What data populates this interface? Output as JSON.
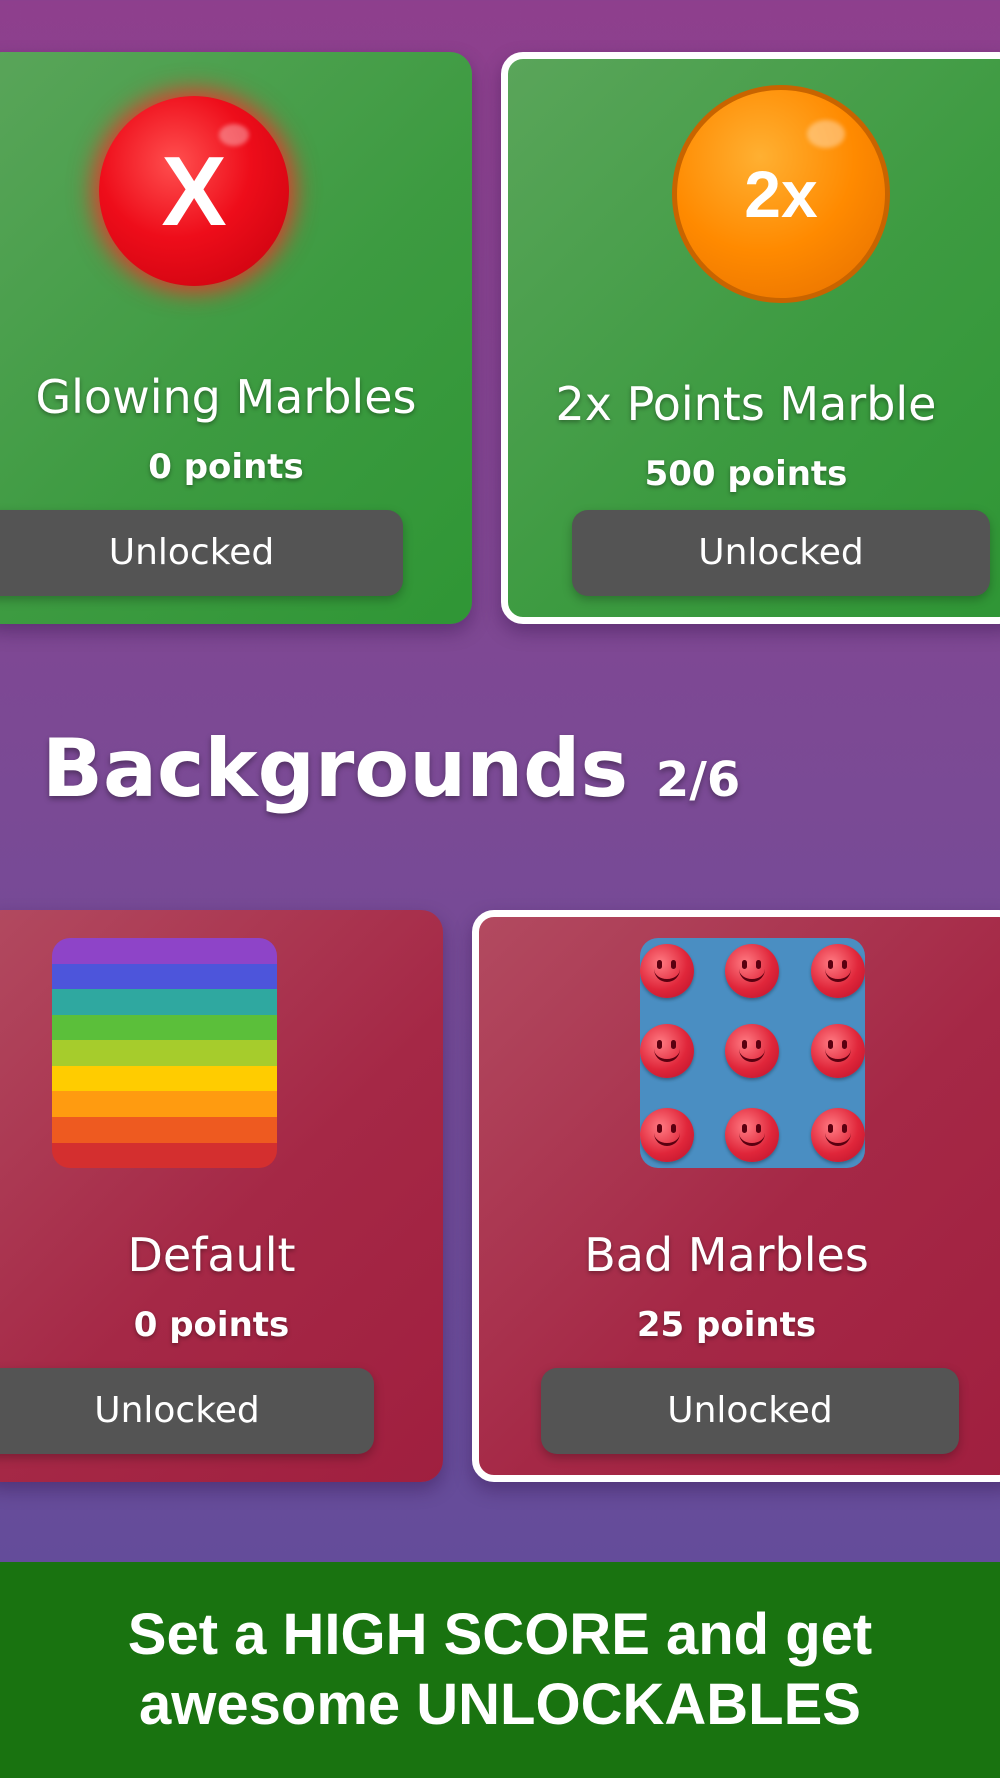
{
  "marbles": {
    "items": [
      {
        "name": "Glowing Marbles",
        "points": "0 points",
        "button": "Unlocked",
        "icon": "red-x-marble-icon",
        "icon_text": "X",
        "selected": false
      },
      {
        "name": "2x Points Marble",
        "points": "500 points",
        "button": "Unlocked",
        "icon": "orange-2x-marble-icon",
        "icon_text": "2x",
        "selected": true
      }
    ]
  },
  "backgrounds": {
    "title": "Backgrounds",
    "count": "2/6",
    "items": [
      {
        "name": "Default",
        "points": "0 points",
        "button": "Unlocked",
        "icon": "rainbow-background-thumbnail",
        "selected": false
      },
      {
        "name": "Bad Marbles",
        "points": "25 points",
        "button": "Unlocked",
        "icon": "smiley-marbles-background-thumbnail",
        "selected": true
      }
    ]
  },
  "promo": {
    "line1": "Set a HIGH SCORE and get",
    "line2": "awesome UNLOCKABLES"
  },
  "colors": {
    "marble_card": "#3d9b41",
    "background_card": "#a52846",
    "button": "#545454",
    "footer": "#197310"
  }
}
